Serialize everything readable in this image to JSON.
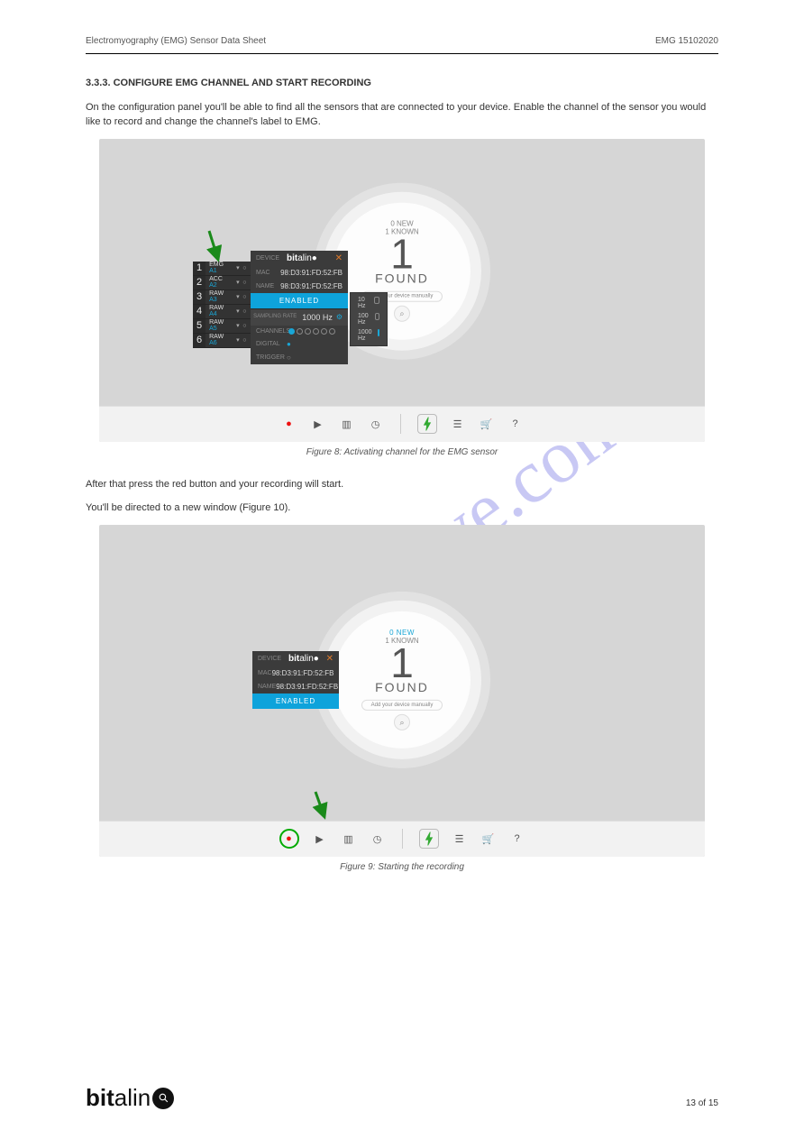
{
  "header": {
    "left": "Electromyography (EMG) Sensor Data Sheet",
    "right": "EMG 15102020"
  },
  "section": {
    "title1": "3.3.3.  CONFIGURE EMG CHANNEL AND START RECORDING"
  },
  "para1": "On the configuration panel you'll be able to find all the sensors that are connected to your device. Enable the channel of the sensor you would like to record and change the channel's label to EMG.",
  "para2": "After that press the red button and your recording will start.",
  "para3": "You'll be directed to a new window (Figure 10).",
  "caption1": "Figure 8: Activating channel for the EMG sensor",
  "caption2": "Figure 9: Starting the recording",
  "found": {
    "new": "0  NEW",
    "known": "1  KNOWN",
    "count": "1",
    "label": "FOUND",
    "addText": "Add your device manually"
  },
  "faded": {
    "new": "0  NEW",
    "known": "1  KNOWN"
  },
  "device": {
    "deviceLbl": "DEVICE",
    "macLbl": "MAC",
    "nameLbl": "NAME",
    "logo": "bitalino",
    "mac": "98:D3:91:FD:52:FB",
    "name": "98:D3:91:FD:52:FB",
    "enabled": "ENABLED",
    "samplingLbl": "SAMPLING RATE",
    "samplingVal": "1000 Hz",
    "channelsLbl": "CHANNELS",
    "digitalLbl": "DIGITAL",
    "triggerLbl": "TRIGGER"
  },
  "channels": [
    {
      "n": "1",
      "t1": "EMG",
      "t2": "A1"
    },
    {
      "n": "2",
      "t1": "ACC",
      "t2": "A2"
    },
    {
      "n": "3",
      "t1": "RAW",
      "t2": "A3"
    },
    {
      "n": "4",
      "t1": "RAW",
      "t2": "A4"
    },
    {
      "n": "5",
      "t1": "RAW",
      "t2": "A5"
    },
    {
      "n": "6",
      "t1": "RAW",
      "t2": "A6"
    }
  ],
  "rates": [
    {
      "v": "10 Hz",
      "sel": false
    },
    {
      "v": "100 Hz",
      "sel": false
    },
    {
      "v": "1000 Hz",
      "sel": true
    }
  ],
  "footer": {
    "logo": "bitalino",
    "page": "13 of  15"
  },
  "watermark": "manualshive.com"
}
